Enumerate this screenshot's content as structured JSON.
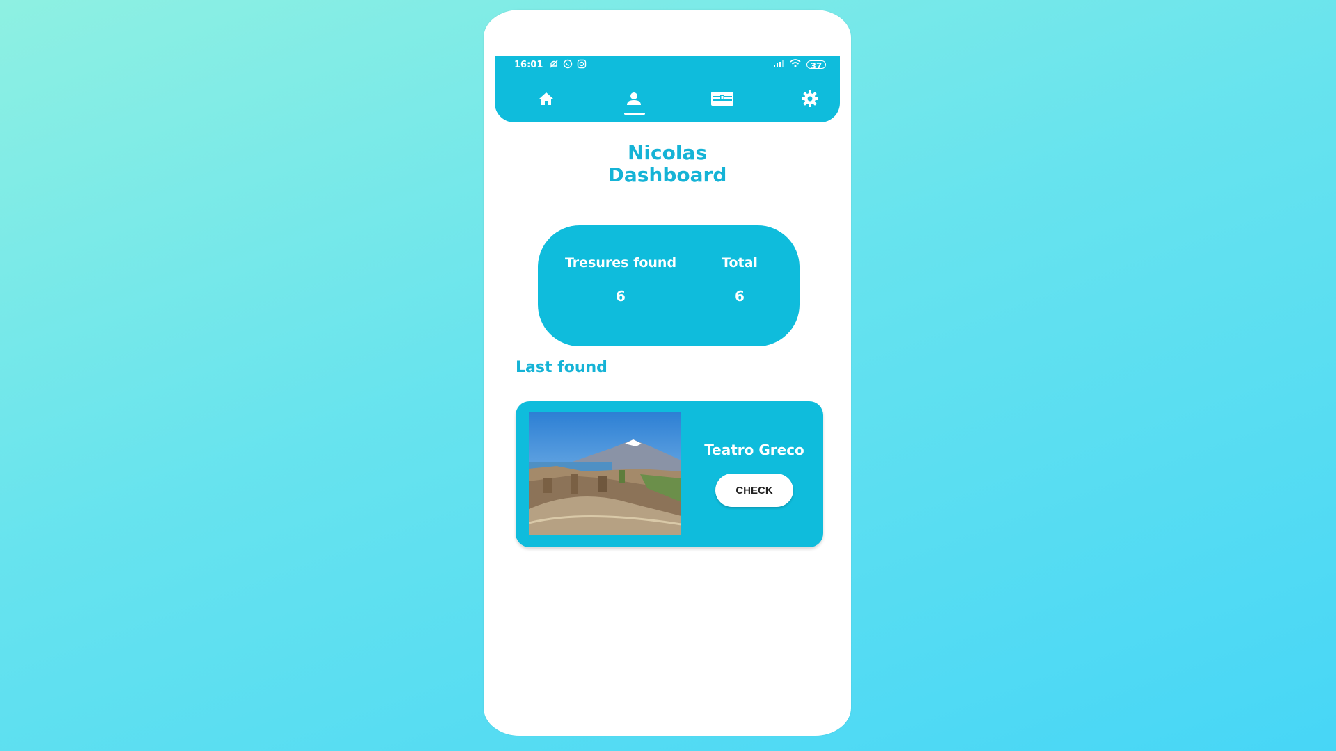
{
  "status_bar": {
    "time": "16:01",
    "battery": "37",
    "notification_icons": [
      "silent-icon",
      "whatsapp-icon",
      "instagram-icon"
    ],
    "system_icons": [
      "signal-icon",
      "wifi-icon",
      "battery-icon"
    ]
  },
  "nav": {
    "items": [
      {
        "icon": "home-icon",
        "active": false
      },
      {
        "icon": "profile-icon",
        "active": true
      },
      {
        "icon": "treasure-chest-icon",
        "active": false
      },
      {
        "icon": "gear-icon",
        "active": false
      }
    ]
  },
  "dashboard": {
    "title_line1": "Nicolas",
    "title_line2": "Dashboard"
  },
  "stats": {
    "found_label": "Tresures found",
    "found_value": "6",
    "total_label": "Total",
    "total_value": "6"
  },
  "last_found": {
    "section_title": "Last found",
    "name": "Teatro Greco",
    "check_label": "CHECK"
  },
  "colors": {
    "accent": "#0fbcdc",
    "title_text": "#15b3d6",
    "background_top": "#8ef0e2",
    "background_bottom": "#47d6f6"
  }
}
